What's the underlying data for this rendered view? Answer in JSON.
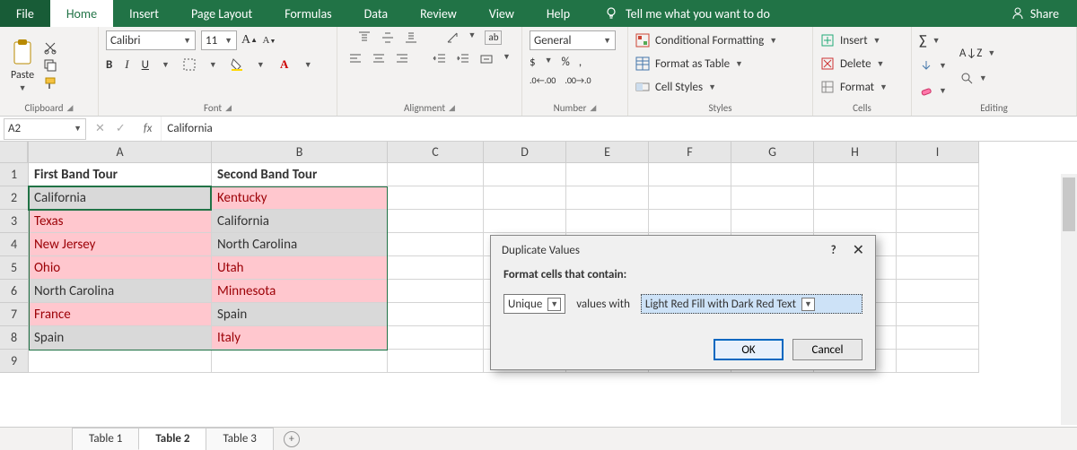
{
  "tabs": {
    "file": "File",
    "home": "Home",
    "insert": "Insert",
    "pageLayout": "Page Layout",
    "formulas": "Formulas",
    "data": "Data",
    "review": "Review",
    "view": "View",
    "help": "Help",
    "tellme": "Tell me what you want to do",
    "share": "Share"
  },
  "ribbon": {
    "clipboard": {
      "paste": "Paste",
      "label": "Clipboard"
    },
    "font": {
      "name": "Calibri",
      "size": "11",
      "label": "Font"
    },
    "alignment": {
      "wrap": "ab",
      "label": "Alignment"
    },
    "number": {
      "format": "General",
      "label": "Number"
    },
    "styles": {
      "cond": "Conditional Formatting",
      "fat": "Format as Table",
      "cs": "Cell Styles",
      "label": "Styles"
    },
    "cells": {
      "insert": "Insert",
      "delete": "Delete",
      "format": "Format",
      "label": "Cells"
    },
    "editing": {
      "label": "Editing"
    }
  },
  "formulaBar": {
    "name": "A2",
    "value": "California",
    "fx": "fx"
  },
  "columns": [
    "A",
    "B",
    "C",
    "D",
    "E",
    "F",
    "G",
    "H",
    "I"
  ],
  "rows": [
    "1",
    "2",
    "3",
    "4",
    "5",
    "6",
    "7",
    "8",
    "9"
  ],
  "table": {
    "headers": [
      "First Band Tour",
      "Second Band Tour"
    ],
    "data": [
      [
        {
          "v": "California",
          "cls": "uniq"
        },
        {
          "v": "Kentucky",
          "cls": "dup"
        }
      ],
      [
        {
          "v": "Texas",
          "cls": "dup"
        },
        {
          "v": "California",
          "cls": "uniq"
        }
      ],
      [
        {
          "v": "New Jersey",
          "cls": "dup"
        },
        {
          "v": "North Carolina",
          "cls": "uniq"
        }
      ],
      [
        {
          "v": "Ohio",
          "cls": "dup"
        },
        {
          "v": "Utah",
          "cls": "dup"
        }
      ],
      [
        {
          "v": "North Carolina",
          "cls": "uniq"
        },
        {
          "v": "Minnesota",
          "cls": "dup"
        }
      ],
      [
        {
          "v": "France",
          "cls": "dup"
        },
        {
          "v": "Spain",
          "cls": "uniq"
        }
      ],
      [
        {
          "v": "Spain",
          "cls": "uniq"
        },
        {
          "v": "Italy",
          "cls": "dup"
        }
      ]
    ]
  },
  "sheets": [
    "Table 1",
    "Table 2",
    "Table 3"
  ],
  "activeSheet": 1,
  "dialog": {
    "title": "Duplicate Values",
    "subtitle": "Format cells that contain:",
    "sel1": "Unique",
    "mid": "values with",
    "sel2": "Light Red Fill with Dark Red Text",
    "ok": "OK",
    "cancel": "Cancel"
  }
}
